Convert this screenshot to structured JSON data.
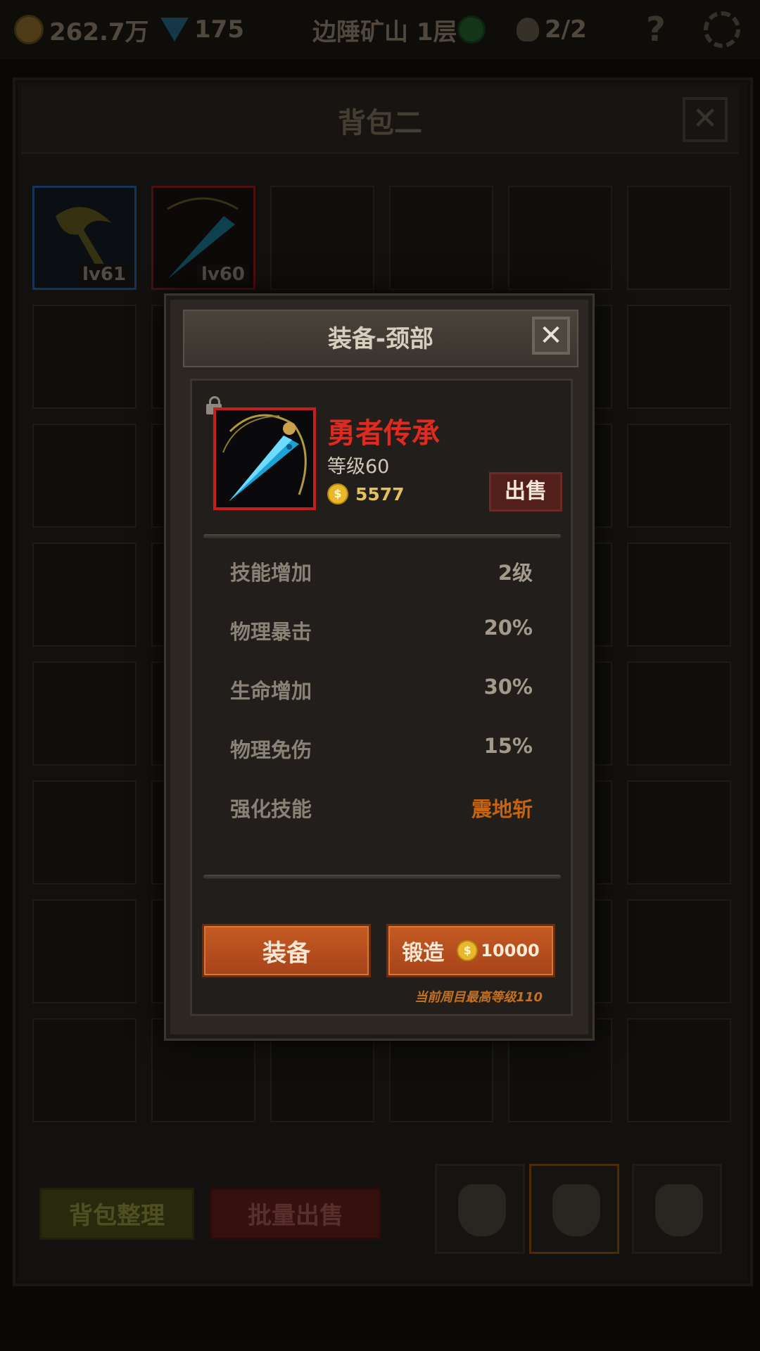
{
  "hud": {
    "gold": "262.7万",
    "gems": "175",
    "location": "边陲矿山 1层",
    "kills": "2/2",
    "help": "?"
  },
  "backpack": {
    "title": "背包二",
    "close_label": "✕",
    "items": [
      {
        "level": "lv61",
        "rarity_color": "#1f4a78"
      },
      {
        "level": "lv60",
        "rarity_color": "#6a1616"
      }
    ],
    "sort_button": "背包整理",
    "bulk_sell_button": "批量出售"
  },
  "modal": {
    "title": "装备-颈部",
    "close_label": "✕",
    "item": {
      "name": "勇者传承",
      "level": "等级60",
      "price": "5577",
      "name_color": "#e02a1f"
    },
    "sell_button": "出售",
    "stats": [
      {
        "label": "技能增加",
        "value": "2级"
      },
      {
        "label": "物理暴击",
        "value": "20%"
      },
      {
        "label": "生命增加",
        "value": "30%"
      },
      {
        "label": "物理免伤",
        "value": "15%"
      },
      {
        "label": "强化技能",
        "value": "震地斩"
      }
    ],
    "equip_button": "装备",
    "forge_button": "锻造",
    "forge_cost": "10000",
    "note": "当前周目最高等级110",
    "coin_symbol": "$"
  }
}
